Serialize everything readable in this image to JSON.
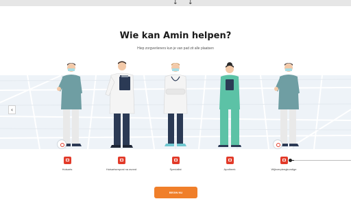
{
  "header": {
    "title": "Wie kan Amin helpen?",
    "subtitle": "Hiep zorgverleners kun je van pad zit alle plaatsen"
  },
  "carousel": {
    "prev_icon": "chevron-left-icon",
    "progress_fraction": 0.05,
    "choices": [
      {
        "label": "Huisarts",
        "icon": "calendar-icon"
      },
      {
        "label": "Huisartsenpost na avond",
        "icon": "calendar-icon"
      },
      {
        "label": "Specialist",
        "icon": "calendar-icon"
      },
      {
        "label": "Apotheek",
        "icon": "calendar-icon"
      },
      {
        "label": "Wijkverpleegkundige",
        "icon": "calendar-icon"
      }
    ]
  },
  "cta": {
    "label": "Begin nu"
  },
  "colors": {
    "accent": "#e23b2a",
    "cta": "#f07f2a",
    "map": "#eef3f8",
    "teal": "#6f9ea3",
    "scrub": "#5cc2a6",
    "navy": "#2b3a55"
  }
}
